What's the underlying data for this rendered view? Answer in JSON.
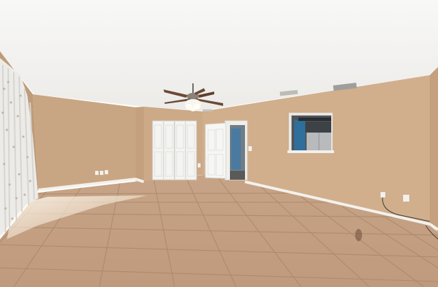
{
  "photo": {
    "subject": "empty room",
    "palette": {
      "ceiling": "#f6f6f4",
      "wall": "#cfae8c",
      "wall_shadow": "#c09e7c",
      "baseboard": "#f2f0ea",
      "floor": "#c9a486",
      "floor_grout": "#a88668",
      "door": "#f5f5f3",
      "curtain": "#ecebe8",
      "kitchen_blue": "#2f6f9c",
      "fridge": "#b7b9bb"
    },
    "fixtures": [
      "ceiling-fan",
      "closet-bifold-doors",
      "open-door",
      "pass-through-window",
      "sheer-curtains",
      "air-vents",
      "wall-outlets",
      "floor-tiles"
    ]
  }
}
